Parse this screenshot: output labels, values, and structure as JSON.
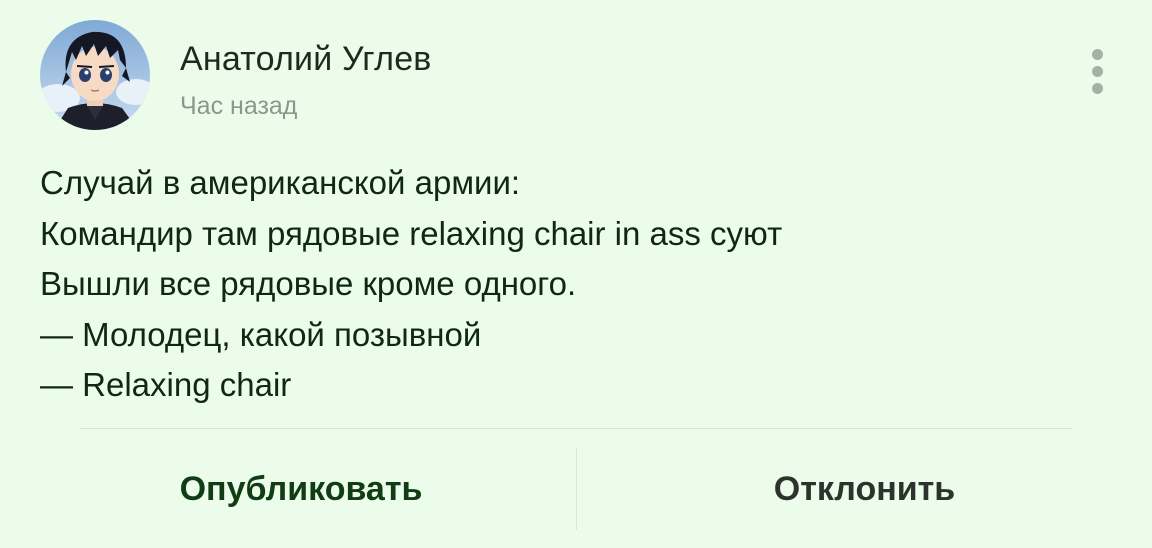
{
  "post": {
    "author": {
      "name": "Анатолий Углев",
      "avatar_icon": "anime-character-avatar"
    },
    "timestamp": "Час назад",
    "menu_icon": "more-vertical-icon",
    "lines": [
      "Случай в американской армии:",
      "Командир там рядовые relaxing chair in ass суют",
      "Вышли все рядовые кроме одного.",
      "— Молодец, какой позывной",
      "— Relaxing chair"
    ]
  },
  "actions": {
    "publish_label": "Опубликовать",
    "reject_label": "Отклонить"
  },
  "colors": {
    "background": "#ecfcea",
    "text": "#0f2810",
    "muted": "#8c968c",
    "publish": "#123d14",
    "reject": "#2c322c"
  }
}
